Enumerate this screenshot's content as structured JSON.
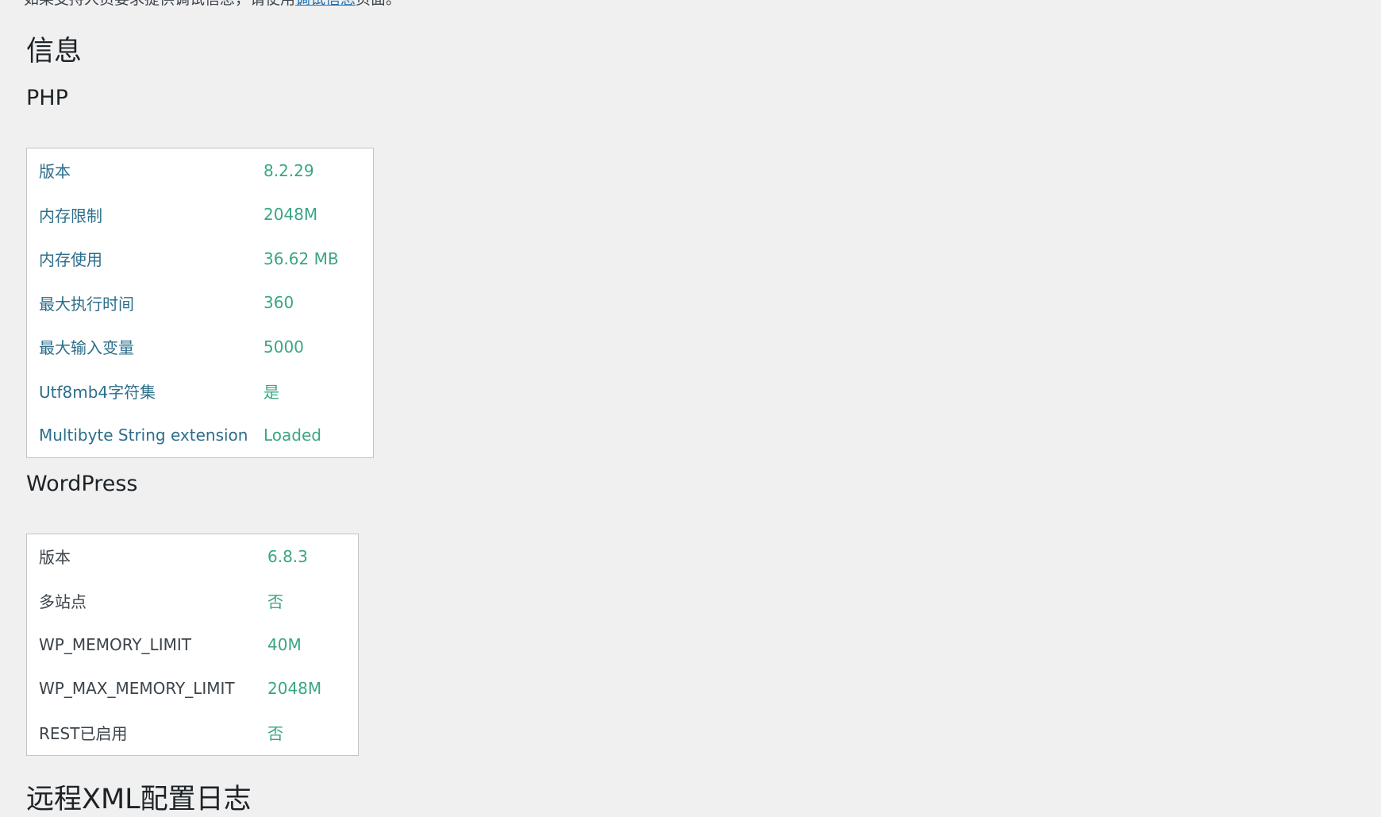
{
  "top_note": {
    "text_before": "如果支持人员要求提供调试信息，请使用",
    "link": "调试信息",
    "text_after": "页面。"
  },
  "info_heading": "信息",
  "php": {
    "title": "PHP",
    "rows": [
      {
        "label": "版本",
        "value": "8.2.29"
      },
      {
        "label": "内存限制",
        "value": "2048M"
      },
      {
        "label": "内存使用",
        "value": "36.62 MB"
      },
      {
        "label": "最大执行时间",
        "value": "360"
      },
      {
        "label": "最大输入变量",
        "value": "5000"
      },
      {
        "label": "Utf8mb4字符集",
        "value": "是"
      },
      {
        "label": "Multibyte String extension",
        "value": "Loaded"
      }
    ]
  },
  "wordpress": {
    "title": "WordPress",
    "rows": [
      {
        "label": "版本",
        "value": "6.8.3"
      },
      {
        "label": "多站点",
        "value": "否"
      },
      {
        "label": "WP_MEMORY_LIMIT",
        "value": "40M"
      },
      {
        "label": "WP_MAX_MEMORY_LIMIT",
        "value": "2048M"
      },
      {
        "label": "REST已启用",
        "value": "否"
      }
    ]
  },
  "remote_log_heading": "远程XML配置日志",
  "colors": {
    "background": "#f0f0f1",
    "value_text": "#3aa585",
    "php_label_text": "#2c6e8b",
    "link": "#2271b1"
  }
}
